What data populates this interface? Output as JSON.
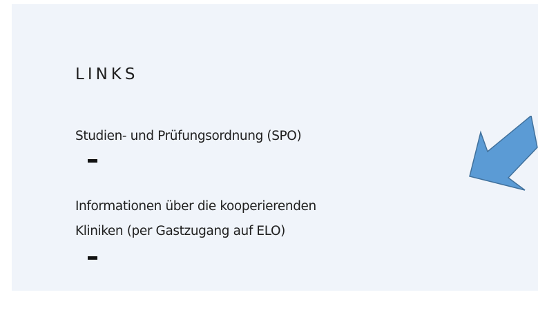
{
  "links_section": {
    "heading": "LINKS",
    "items": [
      {
        "label": "Studien- und Prüfungsordnung (SPO)"
      },
      {
        "line1": "Informationen über die kooperierenden",
        "line2": "Kliniken (per Gastzugang auf ELO)"
      }
    ]
  },
  "annotation": {
    "icon": "arrow-pointer-icon",
    "fill_color": "#5b9bd5",
    "stroke_color": "#41719c"
  },
  "colors": {
    "panel_background": "#f0f4fa",
    "text": "#1f1f1f"
  }
}
